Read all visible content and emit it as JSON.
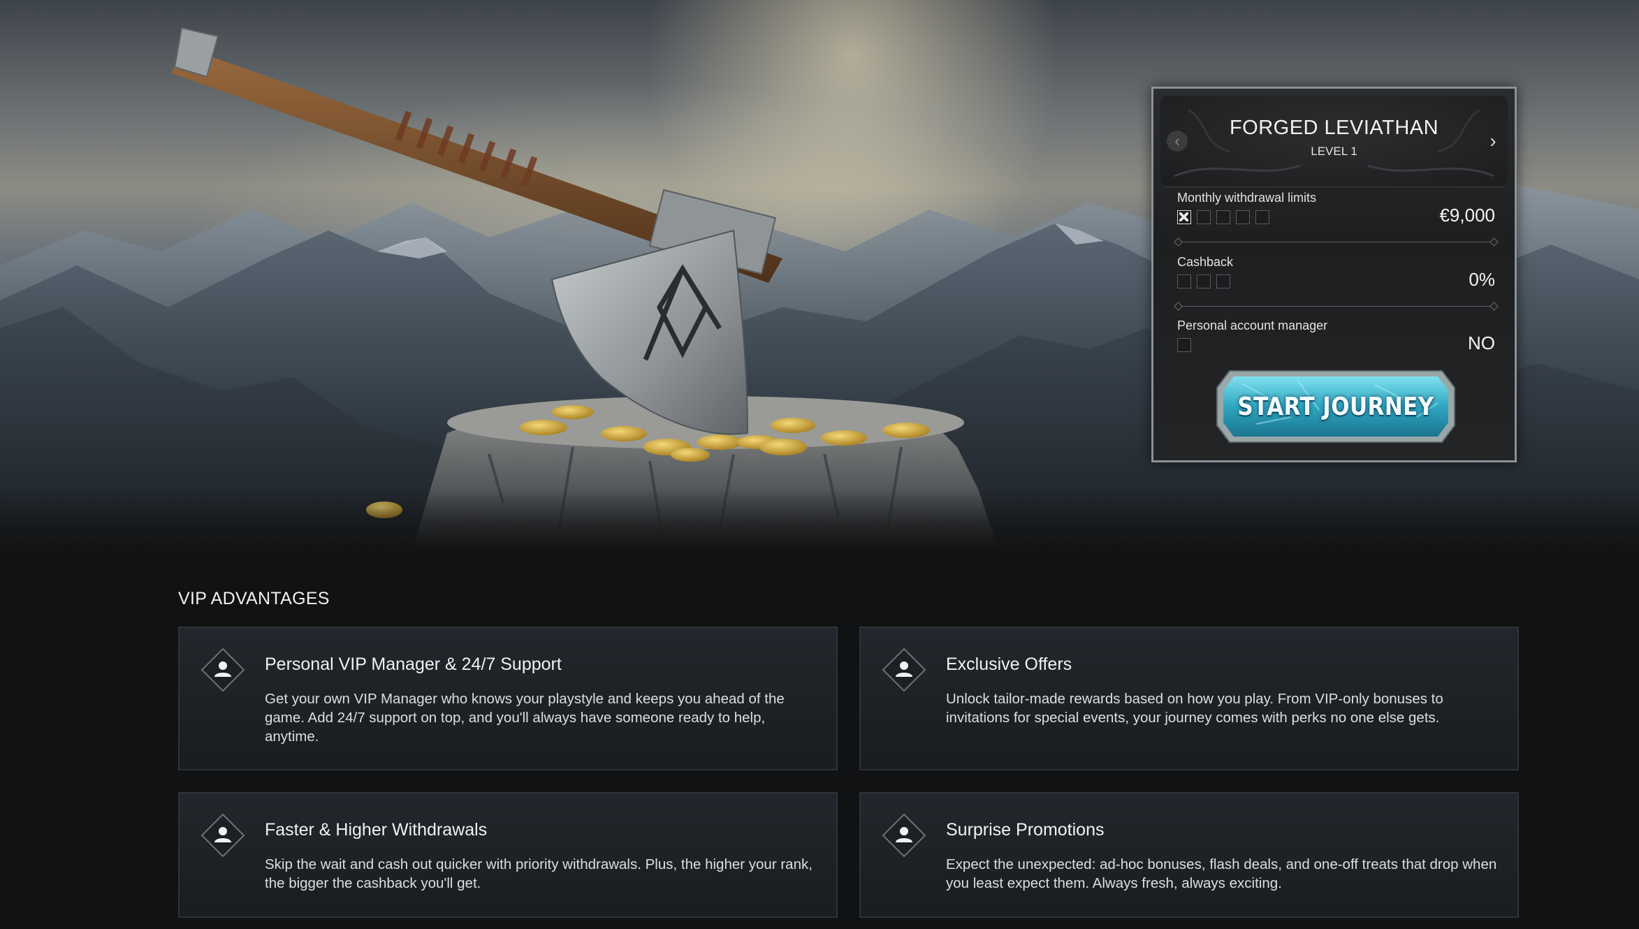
{
  "vip_card": {
    "tier_name": "FORGED LEVIATHAN",
    "tier_level": "LEVEL 1",
    "prev_arrow": "‹",
    "next_arrow": "›",
    "perks": [
      {
        "label": "Monthly withdrawal limits",
        "value": "€9,000",
        "boxes_total": 5,
        "boxes_filled": 1
      },
      {
        "label": "Cashback",
        "value": "0%",
        "boxes_total": 3,
        "boxes_filled": 0
      },
      {
        "label": "Personal account manager",
        "value": "NO",
        "boxes_total": 1,
        "boxes_filled": 0
      }
    ],
    "cta_label": "START JOURNEY"
  },
  "advantages": {
    "title": "VIP ADVANTAGES",
    "items": [
      {
        "icon": "user-icon",
        "title": "Personal VIP Manager & 24/7 Support",
        "text": "Get your own VIP Manager who knows your playstyle and keeps you ahead of the game. Add 24/7 support on top, and you'll always have someone ready to help, anytime."
      },
      {
        "icon": "user-icon",
        "title": "Exclusive Offers",
        "text": "Unlock tailor-made rewards based on how you play. From VIP-only bonuses to invitations for special events, your journey comes with perks no one else gets."
      },
      {
        "icon": "user-icon",
        "title": "Faster & Higher Withdrawals",
        "text": "Skip the wait and cash out quicker with priority withdrawals. Plus, the higher your rank, the bigger the cashback you'll get."
      },
      {
        "icon": "user-icon",
        "title": "Surprise Promotions",
        "text": "Expect the unexpected: ad-hoc bonuses, flash deals, and one-off treats that drop when you least expect them. Always fresh, always exciting."
      }
    ]
  },
  "colors": {
    "page_background": "#111213",
    "card_border": "#8d9196",
    "cta_cyan": "#3fb6cc",
    "gold_coin": "#d9b247"
  }
}
